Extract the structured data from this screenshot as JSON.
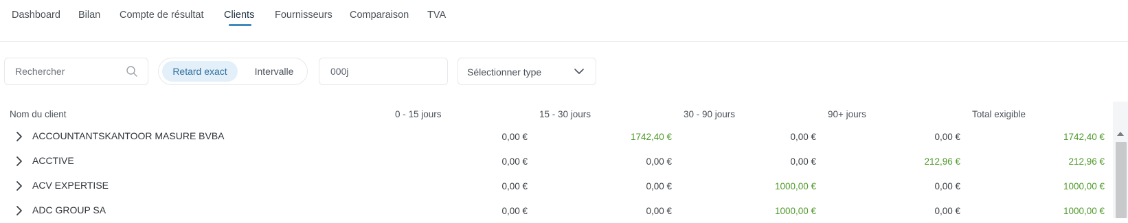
{
  "tabs": [
    "Dashboard",
    "Bilan",
    "Compte de résultat",
    "Clients",
    "Fournisseurs",
    "Comparaison",
    "TVA"
  ],
  "active_tab": "Clients",
  "accent_color": "#3f8bbd",
  "positive_color": "#4e9a2a",
  "filters": {
    "search_placeholder": "Rechercher",
    "search_icon": "search-icon",
    "mode_selected": "Retard exact",
    "mode_other": "Intervalle",
    "delay_value": "000j",
    "type_placeholder": "Sélectionner type",
    "type_icon": "chevron-down-icon"
  },
  "table": {
    "headers": [
      "Nom du client",
      "0 - 15 jours",
      "15 - 30 jours",
      "30 - 90 jours",
      "90+ jours",
      "Total exigible"
    ],
    "rows": [
      {
        "name": "ACCOUNTANTSKANTOOR MASURE BVBA",
        "values": [
          "0,00 €",
          "1742,40 €",
          "0,00 €",
          "0,00 €",
          "1742,40 €"
        ]
      },
      {
        "name": "ACCTIVE",
        "values": [
          "0,00 €",
          "0,00 €",
          "0,00 €",
          "212,96 €",
          "212,96 €"
        ]
      },
      {
        "name": "ACV EXPERTISE",
        "values": [
          "0,00 €",
          "0,00 €",
          "1000,00 €",
          "0,00 €",
          "1000,00 €"
        ]
      },
      {
        "name": "ADC GROUP SA",
        "values": [
          "0,00 €",
          "0,00 €",
          "1000,00 €",
          "0,00 €",
          "1000,00 €"
        ]
      }
    ]
  }
}
